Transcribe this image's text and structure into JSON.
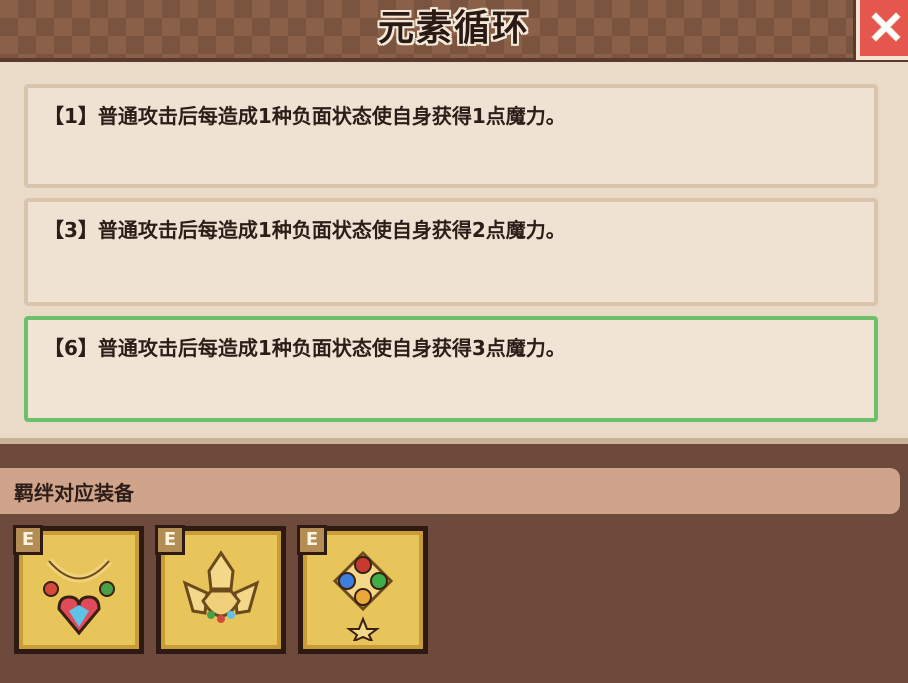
{
  "window": {
    "title": "元素循环"
  },
  "close_button": {
    "icon": "close-x-icon"
  },
  "effects": [
    {
      "text": "【1】普通攻击后每造成1种负面状态使自身获得1点魔力。",
      "active": false
    },
    {
      "text": "【3】普通攻击后每造成1种负面状态使自身获得2点魔力。",
      "active": false
    },
    {
      "text": "【6】普通攻击后每造成1种负面状态使自身获得3点魔力。",
      "active": true
    }
  ],
  "bond_section": {
    "label": "羁绊对应装备"
  },
  "equipment": [
    {
      "badge": "E",
      "icon": "heart-gem-necklace-icon"
    },
    {
      "badge": "E",
      "icon": "golden-crest-icon"
    },
    {
      "badge": "E",
      "icon": "four-gem-amulet-icon"
    }
  ],
  "colors": {
    "active_border": "#6cc06a",
    "close_button": "#e5574e",
    "equipment_background": "#e7c55a"
  }
}
